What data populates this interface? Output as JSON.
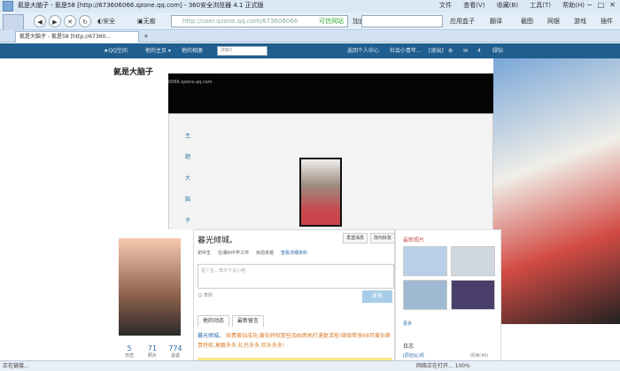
{
  "window": {
    "title": "氦是大脑子 - 氦是58 [http://673606066.qzone.qq.com] - 360安全浏览器 4.1 正式版",
    "menu": [
      "文件",
      "查看(V)",
      "收藏(B)",
      "工具(T)",
      "帮助(H)"
    ]
  },
  "toolbar": {
    "back": "◀",
    "forward": "▶",
    "stop": "✕",
    "refresh": "↻",
    "safe_label": "安全",
    "history_label": "无痕",
    "address": "http://user.qzone.qq.com/673606066",
    "address_badge": "可信网站",
    "add_label": "加速",
    "app_market": "应用盒子",
    "translate": "翻译",
    "screenshot": "截图",
    "netbank": "网银",
    "game": "游戏",
    "more": "插件"
  },
  "tabs": [
    {
      "label": "氦是大脑子 - 氦是58 [http://67360..."
    }
  ],
  "qzone": {
    "logo": "QQ空间",
    "nav": [
      "他的主页 ▾",
      "他的相册"
    ],
    "search_placeholder": "搜索Z",
    "personal_center": "返回个人中心",
    "user": "社会小青年...",
    "logout": "[退出]",
    "badge": "4",
    "vip": "绿钻"
  },
  "banner_text": "氦是大脑子",
  "watermark": "0066.qzone.qq.com",
  "vertical_menu": [
    "主",
    "题",
    "大",
    "脑",
    "子",
    "由",
    "你",
    "作",
    "主"
  ],
  "vertical_more": "更多",
  "profile": {
    "name": "暮光倾城。",
    "send_msg": "发送消息",
    "add_friend": "加为好友",
    "info": [
      "初中生",
      "在湘州中学工作",
      "目前未婚"
    ],
    "info_link": "查看详细资料",
    "textbox_placeholder": "留个言，表示下关心吧",
    "mood": "表情",
    "publish": "发表",
    "tabs": [
      "他的动态",
      "最新留言"
    ],
    "post_author": "暮光倾城。",
    "post_text": "续费黄钻成功,黄钻特权那些加由两地打通复活啦!继续帮享68可黄钻尊贵特权,莫跟多多,礼也多多,欢乐多多!"
  },
  "stats": [
    {
      "num": "5",
      "label": "日志"
    },
    {
      "num": "71",
      "label": "照片"
    },
    {
      "num": "774",
      "label": "说说"
    }
  ],
  "side": {
    "title": "最新照片",
    "more": "更多",
    "diary_title": "日志",
    "diary_item": "[原创]心情",
    "diary_count": "阅读(40)"
  },
  "statusbar": {
    "left": "正在链接...",
    "right": "网络正在打开... 100%"
  }
}
